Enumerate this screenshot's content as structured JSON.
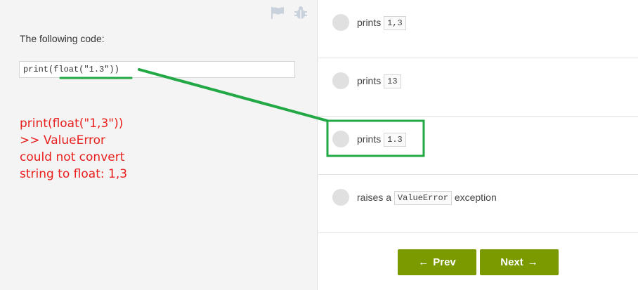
{
  "question": {
    "prompt": "The following code:",
    "code": "print(float(\"1.3\"))"
  },
  "annotation": {
    "note": "print(float(\"1,3\"))\n>> ValueError\ncould not convert\nstring to float: 1,3",
    "color": "#e8201e",
    "highlight_color": "#22a845"
  },
  "options": [
    {
      "prefix": "prints",
      "code": "1,3",
      "suffix": ""
    },
    {
      "prefix": "prints",
      "code": "13",
      "suffix": ""
    },
    {
      "prefix": "prints",
      "code": "1.3",
      "suffix": ""
    },
    {
      "prefix": "raises a",
      "code": "ValueError",
      "suffix": "exception"
    }
  ],
  "nav": {
    "prev_label": "Prev",
    "next_label": "Next",
    "button_color": "#7a9a00"
  },
  "icons": {
    "flag": "flag-icon",
    "bug": "bug-icon"
  }
}
